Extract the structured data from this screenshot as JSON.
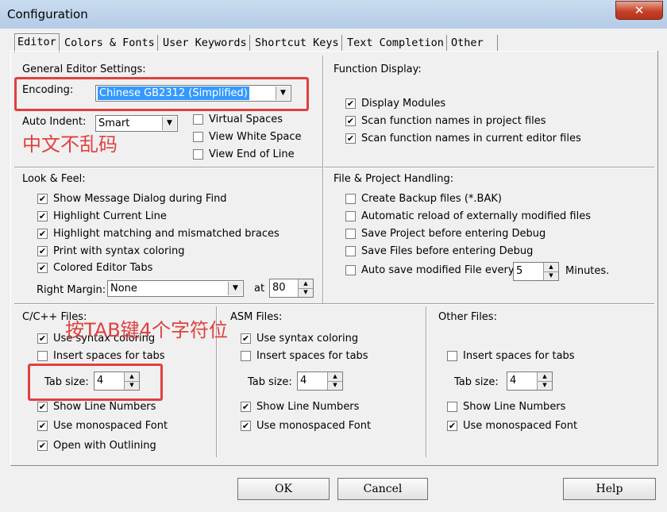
{
  "window": {
    "title": "Configuration",
    "close_glyph": "✕"
  },
  "tabs": [
    {
      "label": "Editor",
      "active": true
    },
    {
      "label": "Colors & Fonts"
    },
    {
      "label": "User Keywords"
    },
    {
      "label": "Shortcut Keys"
    },
    {
      "label": "Text Completion"
    },
    {
      "label": "Other"
    }
  ],
  "general": {
    "title": "General Editor Settings:",
    "encoding_label": "Encoding:",
    "encoding_value": "Chinese GB2312 (Simplified)",
    "auto_indent_label": "Auto Indent:",
    "auto_indent_value": "Smart",
    "virtual_spaces": "Virtual Spaces",
    "view_white_space": "View White Space",
    "view_end_of_line": "View End of Line"
  },
  "function_display": {
    "title": "Function Display:",
    "items": [
      "Display Modules",
      "Scan function names in project files",
      "Scan function names in current editor files"
    ]
  },
  "look_feel": {
    "title": "Look & Feel:",
    "items": [
      "Show Message Dialog during Find",
      "Highlight Current Line",
      "Highlight matching and mismatched braces",
      "Print with syntax coloring",
      "Colored Editor Tabs"
    ],
    "right_margin_label": "Right Margin:",
    "right_margin_value": "None",
    "at_label": "at",
    "at_value": "80"
  },
  "file_project": {
    "title": "File & Project Handling:",
    "items": [
      "Create Backup files (*.BAK)",
      "Automatic reload of externally modified files",
      "Save Project before entering Debug",
      "Save Files before entering Debug",
      "Auto save modified File every"
    ],
    "minutes_value": "5",
    "minutes_label": "Minutes."
  },
  "cpp_files": {
    "title": "C/C++ Files:",
    "use_syntax": "Use syntax coloring",
    "insert_spaces": "Insert spaces for tabs",
    "tab_size_label": "Tab size:",
    "tab_size_value": "4",
    "show_line_numbers": "Show Line Numbers",
    "monospaced": "Use monospaced Font",
    "outlining": "Open with Outlining"
  },
  "asm_files": {
    "title": "ASM Files:",
    "use_syntax": "Use syntax coloring",
    "insert_spaces": "Insert spaces for tabs",
    "tab_size_label": "Tab size:",
    "tab_size_value": "4",
    "show_line_numbers": "Show Line Numbers",
    "monospaced": "Use monospaced Font"
  },
  "other_files": {
    "title": "Other Files:",
    "insert_spaces": "Insert spaces for tabs",
    "tab_size_label": "Tab size:",
    "tab_size_value": "4",
    "show_line_numbers": "Show Line Numbers",
    "monospaced": "Use monospaced Font"
  },
  "buttons": {
    "ok": "OK",
    "cancel": "Cancel",
    "help": "Help"
  },
  "annotations": {
    "encoding_note": "中文不乱码",
    "tab_note": "按TAB键4个字符位",
    "color": "#e04040"
  },
  "check_glyph": "✔",
  "arrow_down": "▼",
  "arrow_up": "▲"
}
